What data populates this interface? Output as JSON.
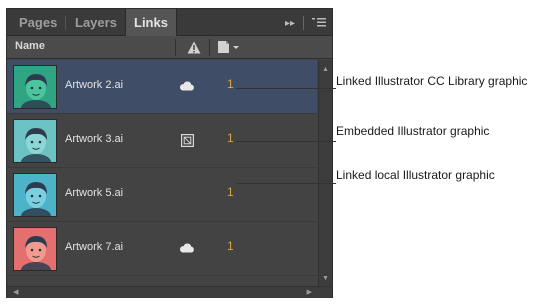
{
  "panel": {
    "tabs": [
      {
        "label": "Pages",
        "active": false
      },
      {
        "label": "Layers",
        "active": false
      },
      {
        "label": "Links",
        "active": true
      }
    ],
    "overflow_icon": "double-chevron-right-icon",
    "menu_icon": "panel-menu-icon",
    "columns": {
      "name": "Name",
      "status_icon": "warning-icon",
      "page_icon": "page-dropdown-icon"
    },
    "rows": [
      {
        "name": "Artwork 2.ai",
        "status_icon": "cloud-icon",
        "page": "1",
        "selected": true,
        "thumb_color": "#2fa583",
        "skin": "#4cc49f"
      },
      {
        "name": "Artwork 3.ai",
        "status_icon": "embedded-icon",
        "page": "1",
        "selected": false,
        "thumb_color": "#6cc2c3",
        "skin": "#8dd5d6"
      },
      {
        "name": "Artwork 5.ai",
        "status_icon": "",
        "page": "1",
        "selected": false,
        "thumb_color": "#4db3c9",
        "skin": "#7ccfe0"
      },
      {
        "name": "Artwork 7.ai",
        "status_icon": "cloud-icon",
        "page": "1",
        "selected": false,
        "thumb_color": "#e36f6f",
        "skin": "#f29a8e"
      }
    ]
  },
  "callouts": [
    {
      "text": "Linked Illustrator CC Library graphic"
    },
    {
      "text": "Embedded Illustrator graphic"
    },
    {
      "text": "Linked local Illustrator graphic"
    }
  ],
  "colors": {
    "panel_bg": "#434343",
    "selection": "#3f4e66",
    "page_number": "#d6a548"
  }
}
